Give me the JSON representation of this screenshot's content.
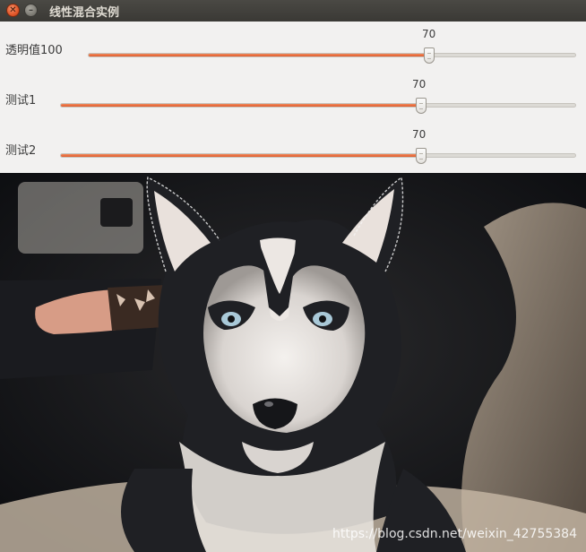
{
  "window": {
    "title": "线性混合实例"
  },
  "trackbars": [
    {
      "label": "透明值100",
      "value": "70",
      "level": 0.7
    },
    {
      "label": "测试1",
      "value": "70",
      "level": 0.7
    },
    {
      "label": "测试2",
      "value": "70",
      "level": 0.7
    }
  ],
  "image": {
    "watermark": "https://blog.csdn.net/weixin_42755384",
    "subject": "husky-puppy"
  },
  "colors": {
    "accent": "#e05a2b",
    "titlebar": "#3c3b37",
    "panel": "#f2f1f0"
  }
}
